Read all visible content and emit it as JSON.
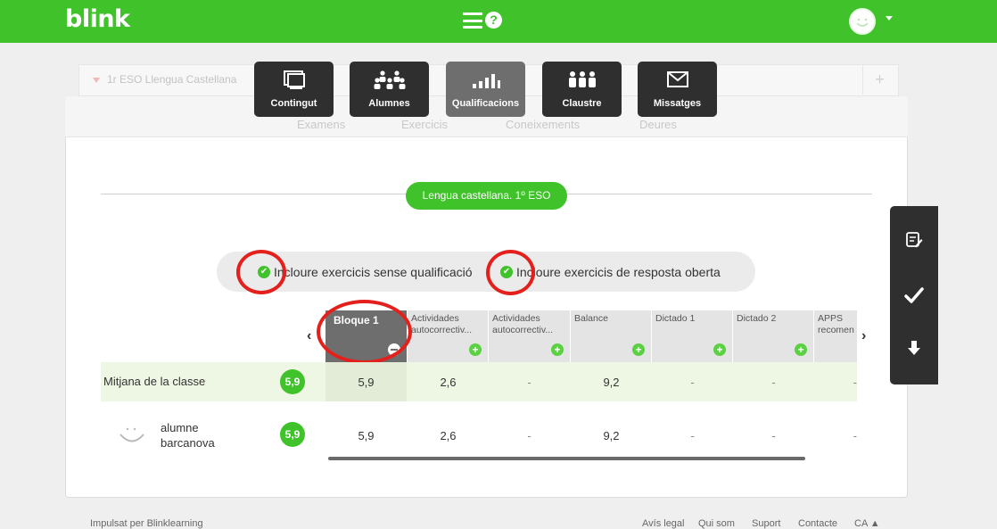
{
  "app": {
    "logo": "blink",
    "help_label": "?"
  },
  "course": {
    "title": "1r ESO Llengua Castellana"
  },
  "menu": [
    {
      "label": "Contingut"
    },
    {
      "label": "Alumnes"
    },
    {
      "label": "Qualificacions"
    },
    {
      "label": "Claustre"
    },
    {
      "label": "Missatges"
    }
  ],
  "subtabs": [
    "Examens",
    "Exercicis",
    "Coneixements",
    "Deures"
  ],
  "section_title": "Lengua castellana. 1º ESO",
  "filters": [
    {
      "label": "Incloure exercicis sense qualificació",
      "checked": true
    },
    {
      "label": "Incloure exercicis de resposta oberta",
      "checked": true
    }
  ],
  "table": {
    "columns": [
      {
        "label": "Bloque 1",
        "badge": "minus"
      },
      {
        "label": "Actividades autocorrectiv...",
        "badge": "plus"
      },
      {
        "label": "Actividades autocorrectiv...",
        "badge": "plus"
      },
      {
        "label": "Balance",
        "badge": "plus"
      },
      {
        "label": "Dictado 1",
        "badge": "plus"
      },
      {
        "label": "Dictado 2",
        "badge": "plus"
      },
      {
        "label": "APPS recomen",
        "badge": ""
      }
    ],
    "rows": [
      {
        "label": "Mitjana de la classe",
        "grade": "5,9",
        "cells": [
          "5,9",
          "2,6",
          "-",
          "9,2",
          "-",
          "-",
          "-"
        ]
      },
      {
        "label": "alumne barcanova",
        "grade": "5,9",
        "cells": [
          "5,9",
          "2,6",
          "-",
          "9,2",
          "-",
          "-",
          "-"
        ]
      }
    ]
  },
  "footer": {
    "powered": "Impulsat per Blinklearning",
    "links": [
      "Avís legal",
      "Qui som",
      "Suport",
      "Contacte",
      "CA ▲"
    ]
  },
  "colors": {
    "brand_green": "#3fc22a",
    "dark_tile": "#2f2f2f",
    "annotation_red": "#e4201d"
  }
}
